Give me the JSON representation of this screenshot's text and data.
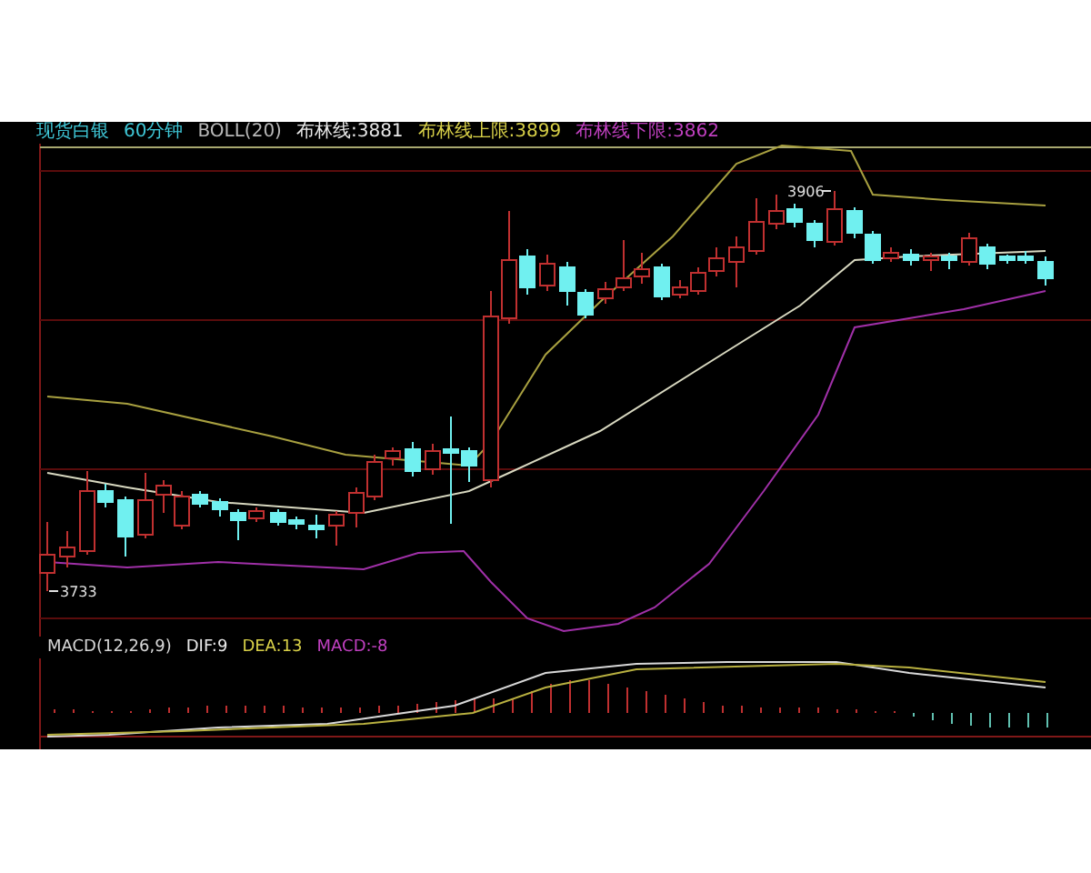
{
  "chart_header": [
    {
      "text": "现货白银",
      "color": "#3fc8d8"
    },
    {
      "text": "60分钟",
      "color": "#3fc8d8"
    },
    {
      "text": "BOLL(20)",
      "color": "#b8b8b8"
    },
    {
      "text": "布林线:3881",
      "color": "#e8e8e8"
    },
    {
      "text": "布林线上限:3899",
      "color": "#d8d048"
    },
    {
      "text": "布林线下限:3862",
      "color": "#c040c0"
    }
  ],
  "price_labels": [
    {
      "text": "3906",
      "kind": "high"
    },
    {
      "text": "3733",
      "kind": "low"
    }
  ],
  "macd_header": [
    {
      "text": "MACD(12,26,9)",
      "color": "#d8d8d8"
    },
    {
      "text": "DIF:9",
      "color": "#e8e8e8"
    },
    {
      "text": "DEA:13",
      "color": "#d8d048"
    },
    {
      "text": "MACD:-8",
      "color": "#c040c0"
    }
  ]
}
